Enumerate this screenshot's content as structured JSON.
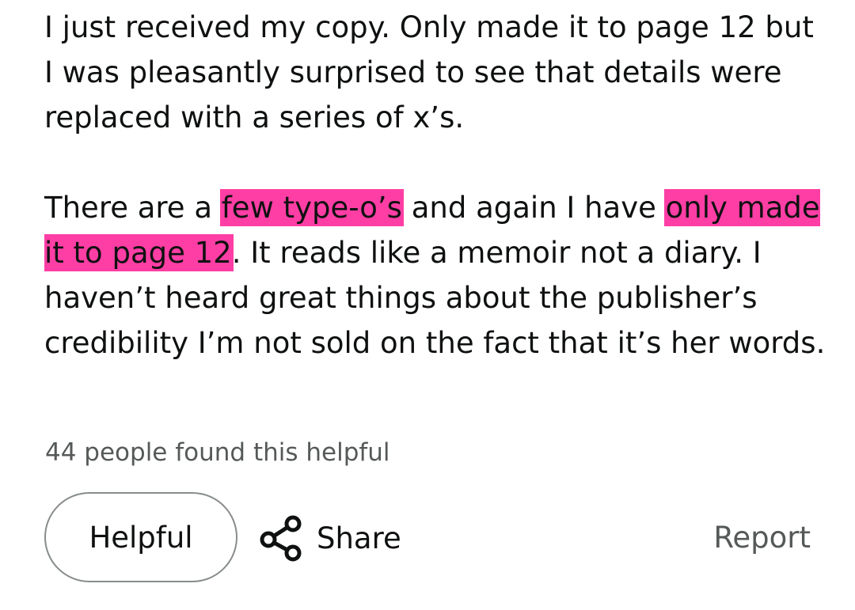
{
  "review": {
    "paragraph1": "I just received my copy. Only made it to page 12 but I was pleasantly surprised to see that details were replaced with a series of x’s.",
    "paragraph2": {
      "part1": "There are a ",
      "highlight1": "few type-o’s",
      "part2": " and again I have ",
      "highlight2": "only made it to page 12",
      "part3": ". It reads like a memoir not a diary. I haven’t heard great things about the publisher’s credibility I’m not sold on the fact that it’s her words."
    },
    "highlight_color": "#ff3ea5"
  },
  "helpful_count_text": "44 people found this helpful",
  "actions": {
    "helpful_label": "Helpful",
    "share_label": "Share",
    "share_icon": "share-icon",
    "report_label": "Report"
  }
}
